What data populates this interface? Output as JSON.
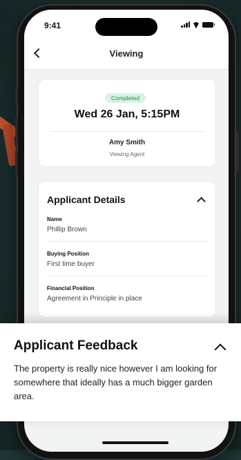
{
  "status": {
    "time": "9:41"
  },
  "nav": {
    "title": "Viewing"
  },
  "appointment": {
    "badge": "Completed",
    "datetime": "Wed 26 Jan, 5:15PM",
    "agent_name": "Amy Smith",
    "agent_role": "Viewing Agent",
    "badge_color": "#1f8a4c"
  },
  "applicant_details": {
    "title": "Applicant Details",
    "fields": [
      {
        "label": "Name",
        "value": "Phillip Brown"
      },
      {
        "label": "Buying Position",
        "value": "First time buyer"
      },
      {
        "label": "Financial Position",
        "value": "Agreement in Principle in place"
      }
    ]
  },
  "feedback": {
    "title": "Applicant Feedback",
    "text": "The property is really nice however I am looking for somewhere that ideally has a much bigger garden area."
  },
  "icons": [
    "back-icon",
    "chevron-up-icon",
    "signal-icon",
    "wifi-icon",
    "battery-icon"
  ]
}
